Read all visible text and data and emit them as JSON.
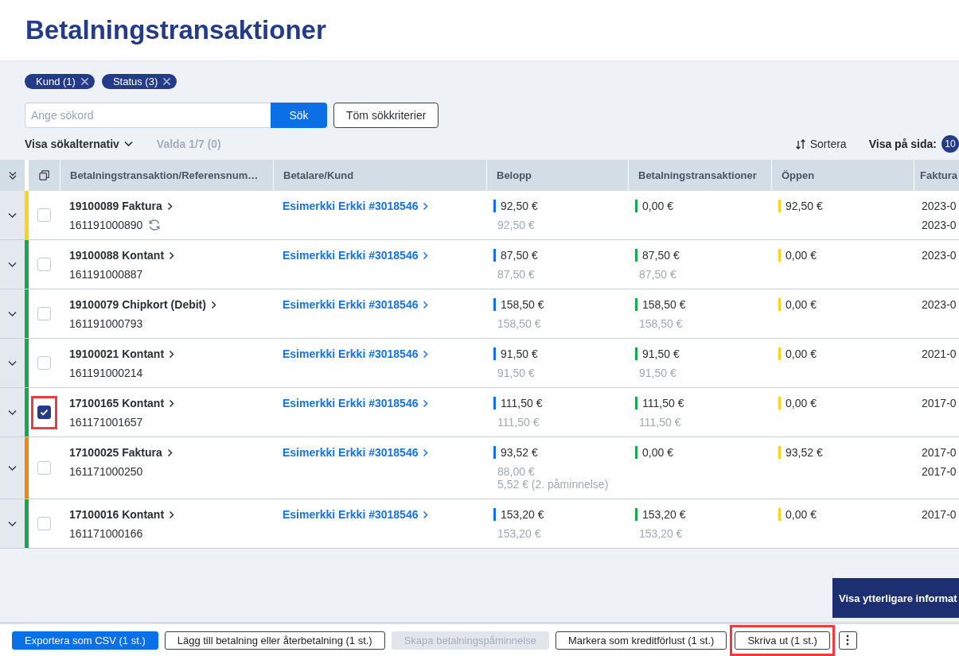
{
  "page_title": "Betalningstransaktioner",
  "filter_chips": [
    {
      "label": "Kund (1)"
    },
    {
      "label": "Status (3)"
    }
  ],
  "search": {
    "placeholder": "Ange sökord",
    "button": "Sök",
    "clear_button": "Töm sökkriterier"
  },
  "options_toggle": {
    "label": "Visa sökalternativ",
    "expanded": false
  },
  "selection_count": "Valda 1/7 (0)",
  "sort_button": "Sortera",
  "page_size": {
    "label": "Visa på sida:",
    "value": "10"
  },
  "table": {
    "columns": [
      {
        "label": "Betalningstransaktion/Referensnum…"
      },
      {
        "label": "Betalare/Kund"
      },
      {
        "label": "Belopp",
        "color": "#1570e6"
      },
      {
        "label": "Betalningstransaktioner",
        "color": "#17a84b"
      },
      {
        "label": "Öppen",
        "color": "#fcd41c"
      },
      {
        "label": "Faktura"
      }
    ],
    "rows": [
      {
        "color": "#fcd41c",
        "expanded": false,
        "selected": false,
        "highlighted": false,
        "transaction": "19100089 Faktura",
        "reference": "161191000890",
        "syncing": true,
        "payer": "Esimerkki Erkki #3018546",
        "amount": "92,50 €",
        "amount_details": [
          "92,50 €"
        ],
        "paid": "0,00 €",
        "open": "92,50 €",
        "invoice_dates": [
          "2023-0",
          "2023-0"
        ]
      },
      {
        "color": "#17a84b",
        "expanded": false,
        "selected": false,
        "highlighted": false,
        "transaction": "19100088 Kontant",
        "reference": "161191000887",
        "syncing": false,
        "payer": "Esimerkki Erkki #3018546",
        "amount": "87,50 €",
        "amount_details": [
          "87,50 €"
        ],
        "paid": "87,50 €",
        "paid_details": [
          "87,50 €"
        ],
        "open": "0,00 €",
        "invoice_dates": [
          "2023-0"
        ]
      },
      {
        "color": "#17a84b",
        "expanded": false,
        "selected": false,
        "highlighted": false,
        "transaction": "19100079 Chipkort (Debit)",
        "reference": "161191000793",
        "syncing": false,
        "payer": "Esimerkki Erkki #3018546",
        "amount": "158,50 €",
        "amount_details": [
          "158,50 €"
        ],
        "paid": "158,50 €",
        "paid_details": [
          "158,50 €"
        ],
        "open": "0,00 €",
        "invoice_dates": [
          "2023-0"
        ]
      },
      {
        "color": "#17a84b",
        "expanded": false,
        "selected": false,
        "highlighted": false,
        "transaction": "19100021 Kontant",
        "reference": "161191000214",
        "syncing": false,
        "payer": "Esimerkki Erkki #3018546",
        "amount": "91,50 €",
        "amount_details": [
          "91,50 €"
        ],
        "paid": "91,50 €",
        "paid_details": [
          "91,50 €"
        ],
        "open": "0,00 €",
        "invoice_dates": [
          "2021-0"
        ]
      },
      {
        "color": "#17a84b",
        "expanded": false,
        "selected": true,
        "highlighted": true,
        "transaction": "17100165 Kontant",
        "reference": "161171001657",
        "syncing": false,
        "payer": "Esimerkki Erkki #3018546",
        "amount": "111,50 €",
        "amount_details": [
          "111,50 €"
        ],
        "paid": "111,50 €",
        "paid_details": [
          "111,50 €"
        ],
        "open": "0,00 €",
        "invoice_dates": [
          "2017-0"
        ]
      },
      {
        "color": "#f7820f",
        "expanded": false,
        "selected": false,
        "highlighted": false,
        "transaction": "17100025 Faktura",
        "reference": "161171000250",
        "syncing": false,
        "payer": "Esimerkki Erkki #3018546",
        "amount": "93,52 €",
        "amount_details": [
          "88,00 €",
          "5,52 € (2. påminnelse)"
        ],
        "paid": "0,00 €",
        "open": "93,52 €",
        "invoice_dates": [
          "2017-0",
          "2017-0"
        ]
      },
      {
        "color": "#17a84b",
        "expanded": false,
        "selected": false,
        "highlighted": false,
        "transaction": "17100016 Kontant",
        "reference": "161171000166",
        "syncing": false,
        "payer": "Esimerkki Erkki #3018546",
        "amount": "153,20 €",
        "amount_details": [
          "153,20 €"
        ],
        "paid": "153,20 €",
        "paid_details": [
          "153,20 €"
        ],
        "open": "0,00 €",
        "invoice_dates": [
          "2017-0"
        ]
      }
    ]
  },
  "info_button": "Visa ytterligare informat",
  "action_buttons": [
    {
      "kind": "primary",
      "label": "Exportera som CSV (1 st.)",
      "disabled": false,
      "highlighted": false
    },
    {
      "kind": "secondary",
      "label": "Lägg till betalning eller återbetalning (1 st.)",
      "disabled": false,
      "highlighted": false
    },
    {
      "kind": "secondary",
      "label": "Skapa betalningspåminnelse",
      "disabled": true,
      "highlighted": false
    },
    {
      "kind": "secondary",
      "label": "Markera som kreditförlust (1 st.)",
      "disabled": false,
      "highlighted": false
    },
    {
      "kind": "secondary",
      "label": "Skriva ut (1 st.)",
      "disabled": false,
      "highlighted": true
    },
    {
      "kind": "more",
      "disabled": false,
      "highlighted": false
    }
  ]
}
